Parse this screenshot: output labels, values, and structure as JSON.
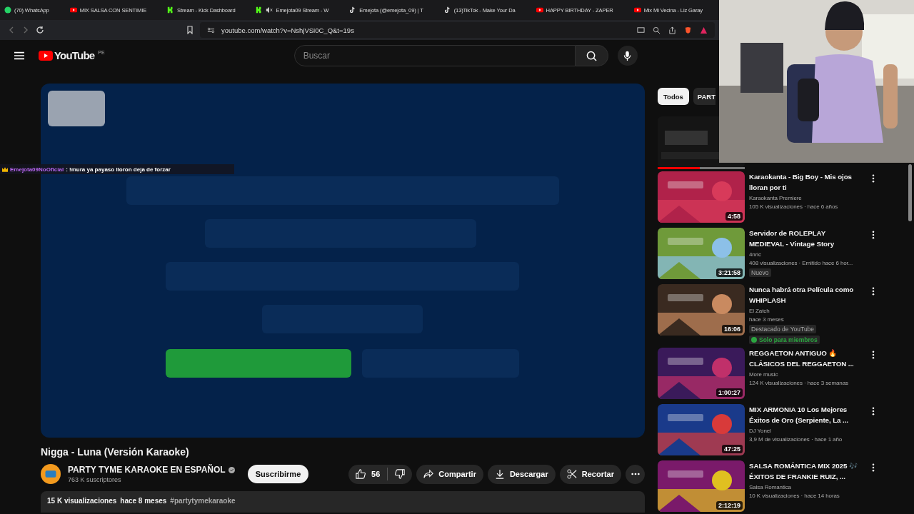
{
  "browser": {
    "tabs": [
      {
        "kind": "whatsapp",
        "title": "(70) WhatsApp"
      },
      {
        "kind": "youtube",
        "title": "MIX SALSA CON SENTIMIE"
      },
      {
        "kind": "kick",
        "title": "Stream - Kick Dashboard"
      },
      {
        "kind": "kick-muted",
        "title": "Emejota09 Stream - W"
      },
      {
        "kind": "tiktok",
        "title": "Emejota (@emejota_09) | T"
      },
      {
        "kind": "tiktok",
        "title": "(13)TikTok - Make Your Da"
      },
      {
        "kind": "youtube",
        "title": "HAPPY BIRTHDAY - ZAPER"
      },
      {
        "kind": "youtube",
        "title": "Mix Mi Vecina - Liz Garay"
      }
    ],
    "address": "youtube.com/watch?v=NshjVSi0C_Q&t=19s"
  },
  "header": {
    "logo": "YouTube",
    "region": "PE",
    "search_placeholder": "Buscar"
  },
  "chat_overlay": {
    "user": "Emejota09NoOficial",
    "message": ": !mura ya payaso lloron deja de forzar"
  },
  "title": "Nigga - Luna (Versión Karaoke)",
  "channel": {
    "name": "PARTY TYME KARAOKE EN ESPAÑOL",
    "subscribers": "763 K suscriptores",
    "verified": true
  },
  "subscribe": "Suscribirme",
  "likes": "56",
  "actions": [
    {
      "kind": "share",
      "label": "Compartir"
    },
    {
      "kind": "download",
      "label": "Descargar"
    },
    {
      "kind": "clip",
      "label": "Recortar"
    }
  ],
  "description": {
    "views": "15 K visualizaciones",
    "date": "hace 8 meses",
    "hashtag": "#partytymekaraoke"
  },
  "chips": [
    {
      "label": "Todos",
      "selected": true
    },
    {
      "label": "PART",
      "selected": false
    }
  ],
  "sidebar": [
    {
      "kind": "partial",
      "level": 0.48
    },
    {
      "kind": "video",
      "title": "Karaokanta - Big Boy - Mis ojos lloran por ti",
      "channel": "Karaokanta Premiere",
      "meta": "105 K visualizaciones · hace 6 años",
      "duration": "4:58"
    },
    {
      "kind": "video",
      "title": "Servidor de ROLEPLAY MEDIEVAL - Vintage Story",
      "channel": "4nric",
      "meta": "408 visualizaciones · Emitido hace 6 hor...",
      "duration": "3:21:58",
      "badge": "Nuevo"
    },
    {
      "kind": "video",
      "title": "Nunca habrá otra Película como WHIPLASH",
      "channel": "El Zatch",
      "meta": "hace 3 meses",
      "duration": "16:06",
      "badge": "Destacado de YouTube",
      "members": "Solo para miembros"
    },
    {
      "kind": "video",
      "title": "REGGAETON ANTIGUO 🔥 CLÁSICOS DEL REGGAETON ...",
      "channel": "More music",
      "meta": "124 K visualizaciones · hace 3 semanas",
      "duration": "1:00:27"
    },
    {
      "kind": "video",
      "title": "MIX ARMONIA 10 Los Mejores Éxitos de Oro (Serpiente, La ...",
      "channel": "DJ Yonel",
      "meta": "3,9 M de visualizaciones · hace 1 año",
      "duration": "47:25"
    },
    {
      "kind": "video",
      "title": "SALSA ROMÁNTICA MIX 2025 🎶 ÉXITOS DE FRANKIE RUIZ, ...",
      "channel": "Salsa Romantica",
      "meta": "10 K visualizaciones · hace 14 horas",
      "duration": "2:12:19"
    }
  ]
}
